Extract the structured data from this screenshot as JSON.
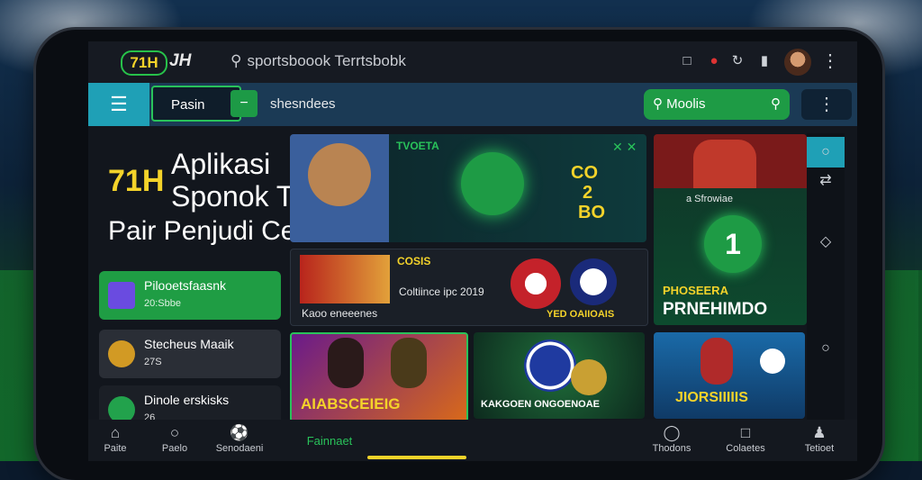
{
  "topbar": {
    "logo_badge": "71H",
    "logo_text": "JH",
    "search_text": "sportsboook  Terrtsbobk"
  },
  "nav": {
    "pill_label": "Pasin",
    "nav_text": "shesndees",
    "search_label": "Moolis"
  },
  "hero": {
    "brand": "71H",
    "line1": "Aplikasi",
    "line2": "Sponok Tosmbaaik",
    "line3": "Pair Penjudi Cerdas"
  },
  "sidebar": {
    "items": [
      {
        "title": "Pilooetsfaasnk",
        "sub": "20:Sbbe"
      },
      {
        "title": "Stecheus Maaik",
        "sub": "27S"
      },
      {
        "title": "Dinole erskisks",
        "sub": "26"
      }
    ]
  },
  "cards": {
    "c1_title": "TVOETA",
    "c1_odds1": "CO",
    "c1_odds2": "2",
    "c1_odds3": "BO",
    "c2_tag": "COSIS",
    "c2_title": "Kaoo eneeenes",
    "c2_sub": "Coltiince ipc 2019",
    "c2_foot": "YED OAIIOAIS",
    "c3_title": "PHOSEERA",
    "c3_big": "PRNEHIMDO",
    "c3_top": "a Sfrowiae",
    "c4_title": "AIABSCEIEIG",
    "c5_title": "KAKGOEN ONGOENOAE",
    "c6_title": "JIORSIIIIIS"
  },
  "bottom": {
    "items": [
      "Paite",
      "Paelo",
      "Senodaeni",
      "Fainnaet",
      "Thodons",
      "Colaetes",
      "Tetioet"
    ]
  },
  "colors": {
    "accent_green": "#29c25a",
    "accent_teal": "#1fa0b6",
    "brand_yellow": "#f4d32a"
  }
}
